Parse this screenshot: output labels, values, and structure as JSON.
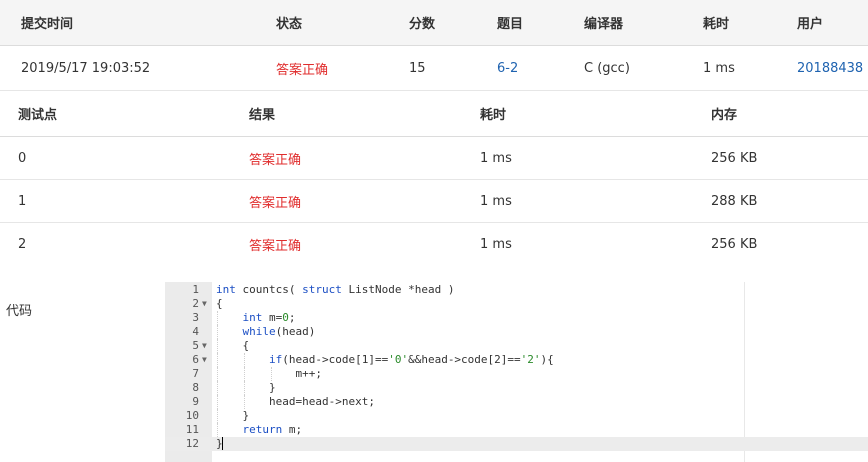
{
  "submission": {
    "headers": [
      "提交时间",
      "状态",
      "分数",
      "题目",
      "编译器",
      "耗时",
      "用户"
    ],
    "row": {
      "time": "2019/5/17 19:03:52",
      "status": "答案正确",
      "score": "15",
      "problem": "6-2",
      "compiler": "C (gcc)",
      "elapsed": "1 ms",
      "user": "20188438"
    }
  },
  "testcases": {
    "headers": [
      "测试点",
      "结果",
      "耗时",
      "内存"
    ],
    "rows": [
      {
        "id": "0",
        "result": "答案正确",
        "time": "1 ms",
        "memory": "256 KB"
      },
      {
        "id": "1",
        "result": "答案正确",
        "time": "1 ms",
        "memory": "288 KB"
      },
      {
        "id": "2",
        "result": "答案正确",
        "time": "1 ms",
        "memory": "256 KB"
      }
    ]
  },
  "code_section": {
    "label": "代码",
    "line_numbers": [
      "1",
      "2",
      "3",
      "4",
      "5",
      "6",
      "7",
      "8",
      "9",
      "10",
      "11",
      "12"
    ],
    "line_texts": [
      "int countcs( struct ListNode *head )",
      "{",
      "    int m=0;",
      "    while(head)",
      "    {",
      "        if(head->code[1]=='0'&&head->code[2]=='2'){",
      "            m++;",
      "        }",
      "        head=head->next;",
      "    }",
      "    return m;",
      "}"
    ],
    "fold_markers": [
      "2",
      "5",
      "6"
    ],
    "active_line": "12"
  },
  "colors": {
    "accepted": "#e02d2d",
    "link": "#1f63b0",
    "keyword": "#1c4fc4",
    "string": "#2a8a2a"
  }
}
